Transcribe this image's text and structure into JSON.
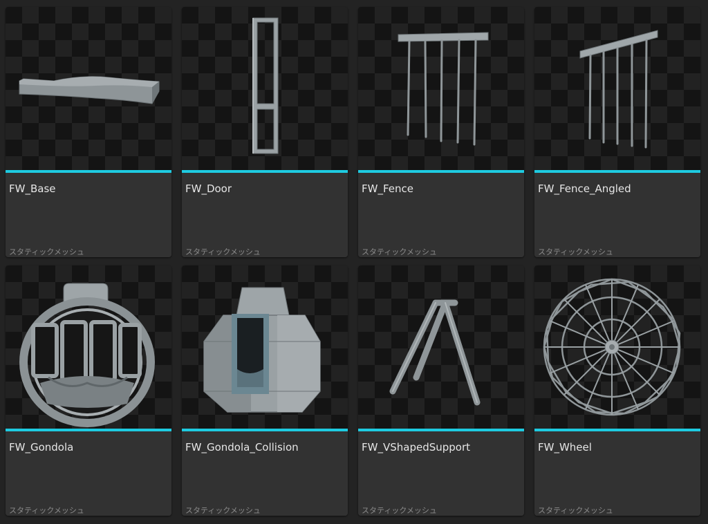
{
  "content_browser": {
    "accent_color": "#1ecbe1",
    "assets": [
      {
        "name": "FW_Base",
        "type": "スタティックメッシュ",
        "icon": "curved-base-mesh"
      },
      {
        "name": "FW_Door",
        "type": "スタティックメッシュ",
        "icon": "door-frame-mesh"
      },
      {
        "name": "FW_Fence",
        "type": "スタティックメッシュ",
        "icon": "fence-mesh"
      },
      {
        "name": "FW_Fence_Angled",
        "type": "スタティックメッシュ",
        "icon": "angled-fence-mesh"
      },
      {
        "name": "FW_Gondola",
        "type": "スタティックメッシュ",
        "icon": "gondola-mesh"
      },
      {
        "name": "FW_Gondola_Collision",
        "type": "スタティックメッシュ",
        "icon": "gondola-collision-mesh"
      },
      {
        "name": "FW_VShapedSupport",
        "type": "スタティックメッシュ",
        "icon": "v-support-mesh"
      },
      {
        "name": "FW_Wheel",
        "type": "スタティックメッシュ",
        "icon": "ferris-wheel-mesh"
      }
    ]
  }
}
